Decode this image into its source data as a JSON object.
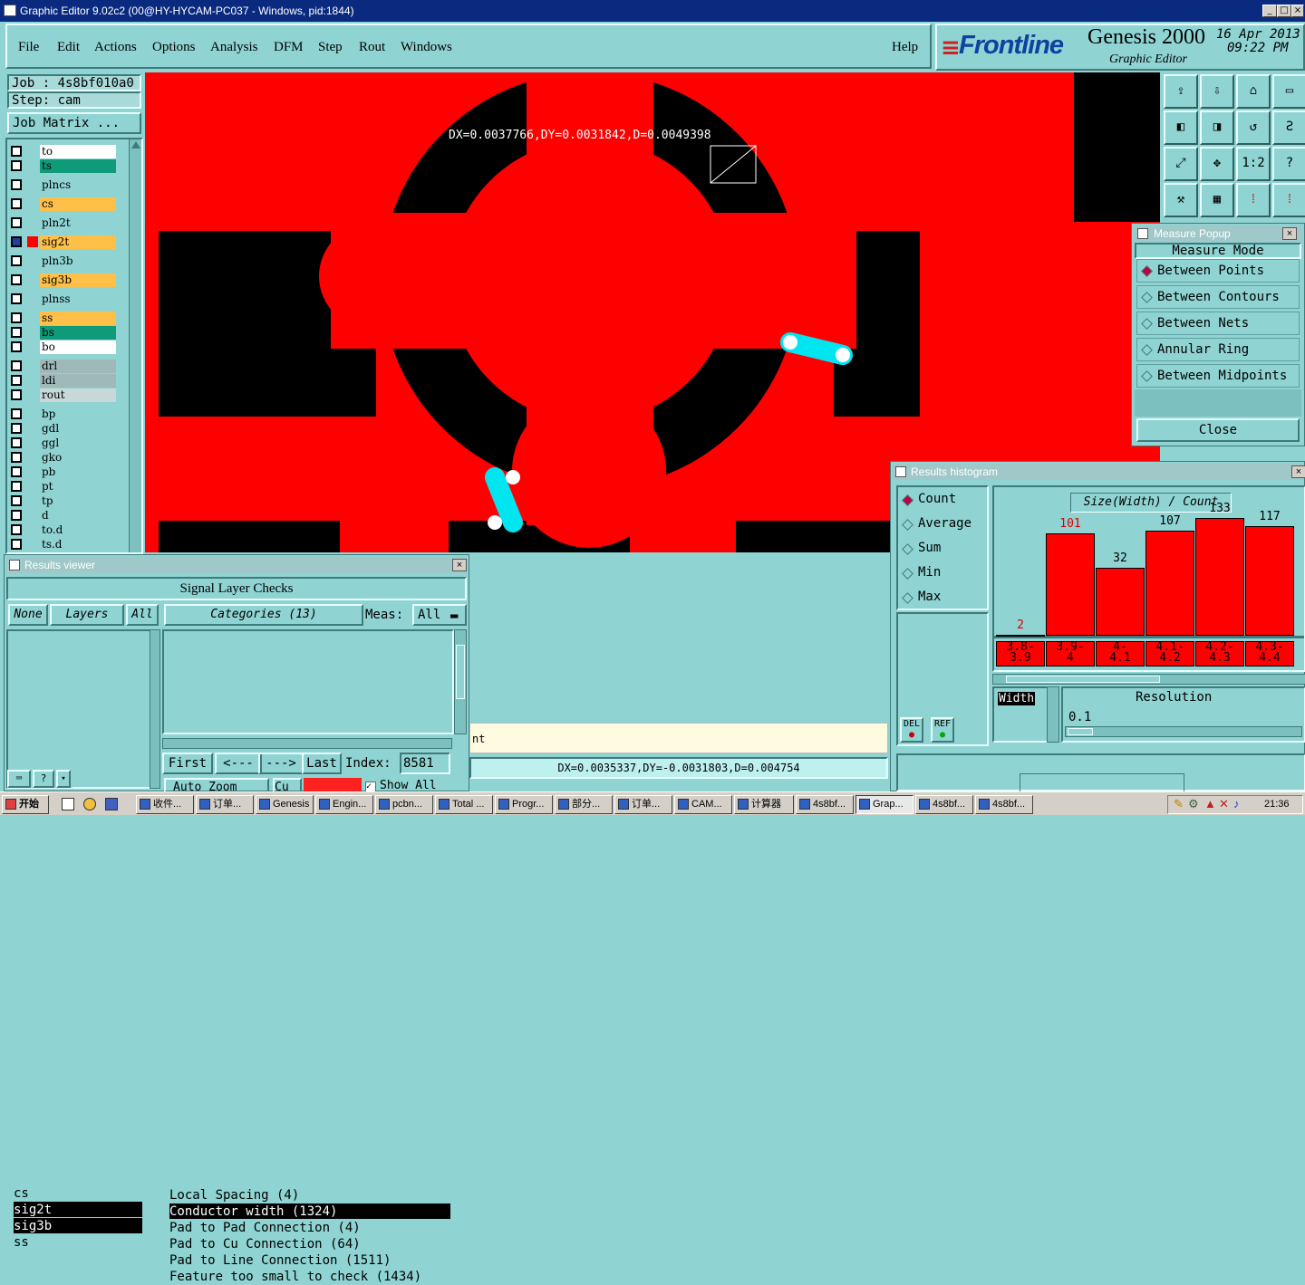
{
  "window": {
    "title": "Graphic Editor 9.02c2 (00@HY-HYCAM-PC037 - Windows, pid:1844)"
  },
  "menu": [
    "File",
    "Edit",
    "Actions",
    "Options",
    "Analysis",
    "DFM",
    "Step",
    "Rout",
    "Windows"
  ],
  "help": "Help",
  "brand": {
    "logo": "Frontline",
    "product": "Genesis 2000",
    "subtitle": "Graphic Editor",
    "date": "16 Apr 2013",
    "time": "09:22 PM"
  },
  "job": {
    "job": "Job : 4s8bf010a0",
    "step": "Step: cam",
    "matrix": "Job Matrix ..."
  },
  "layers": [
    {
      "name": "to",
      "color": "#ffffff"
    },
    {
      "name": "ts",
      "color": "#0f9a7a"
    },
    {
      "name": "plncs",
      "color": "#8fd3d3"
    },
    {
      "name": "cs",
      "color": "#ffc04a"
    },
    {
      "name": "pln2t",
      "color": "#8fd3d3"
    },
    {
      "name": "sig2t",
      "color": "#ffc04a"
    },
    {
      "name": "pln3b",
      "color": "#8fd3d3"
    },
    {
      "name": "sig3b",
      "color": "#ffc04a"
    },
    {
      "name": "plnss",
      "color": "#8fd3d3"
    },
    {
      "name": "ss",
      "color": "#ffc04a"
    },
    {
      "name": "bs",
      "color": "#0f9a7a"
    },
    {
      "name": "bo",
      "color": "#ffffff"
    },
    {
      "name": "drl",
      "color": "#9fb8b8"
    },
    {
      "name": "ldi",
      "color": "#9fb8b8"
    },
    {
      "name": "rout",
      "color": "#c8d8d8"
    },
    {
      "name": "bp",
      "color": "#8fd3d3"
    },
    {
      "name": "gdl",
      "color": "#8fd3d3"
    },
    {
      "name": "ggl",
      "color": "#8fd3d3"
    },
    {
      "name": "gko",
      "color": "#8fd3d3"
    },
    {
      "name": "pb",
      "color": "#8fd3d3"
    },
    {
      "name": "pt",
      "color": "#8fd3d3"
    },
    {
      "name": "tp",
      "color": "#8fd3d3"
    },
    {
      "name": "d",
      "color": "#8fd3d3"
    },
    {
      "name": "to.d",
      "color": "#8fd3d3"
    },
    {
      "name": "ts.d",
      "color": "#8fd3d3"
    }
  ],
  "canvas": {
    "measure_text": "DX=0.0037766,DY=0.0031842,D=0.0049398"
  },
  "toolbar_icons": [
    "step-up-icon",
    "step-down-icon",
    "home-icon",
    "panel-icon",
    "pan-left-icon",
    "pan-right-icon",
    "undo-zoom-icon",
    "route-icon",
    "zoom-fit-icon",
    "zoom-center-icon",
    "one-to-one-icon",
    "help-icon",
    "tool-icon",
    "grid-icon",
    "layer-sig-icon",
    "layer-pad-icon"
  ],
  "one_to_one": "1:2",
  "question": "?",
  "measure": {
    "title": "Measure Popup",
    "mode": "Measure Mode",
    "options": [
      "Between Points",
      "Between Contours",
      "Between Nets",
      "Annular Ring",
      "Between Midpoints"
    ],
    "selected": 0,
    "close": "Close"
  },
  "histogram": {
    "title": "Results histogram",
    "modes": [
      "Count",
      "Average",
      "Sum",
      "Min",
      "Max"
    ],
    "selected": 0,
    "chart_title": "Size(Width) / Count",
    "del": "DEL",
    "ref": "REF",
    "field": "Width",
    "resolution_label": "Resolution",
    "resolution": "0.1"
  },
  "chart_data": {
    "type": "bar",
    "title": "Size(Width) / Count",
    "categories": [
      "3.8-3.9",
      "3.9-4",
      "4-4.1",
      "4.1-4.2",
      "4.2-4.3",
      "4.3-4.4"
    ],
    "cat_top": [
      "3.8-",
      "3.9-",
      "4-",
      "4.1-",
      "4.2-",
      "4.3-"
    ],
    "cat_bottom": [
      "3.9",
      "4",
      "4.1",
      "4.2",
      "4.3",
      "4.4"
    ],
    "values": [
      2,
      101,
      32,
      107,
      133,
      117
    ],
    "ylim": [
      0,
      133
    ]
  },
  "results": {
    "title": "Results viewer",
    "header": "Signal Layer Checks",
    "none": "None",
    "layers_btn": "Layers",
    "all": "All",
    "categories": "Categories (13)",
    "meas_label": "Meas:",
    "meas_val": "All",
    "layer_list": [
      "cs",
      "sig2t",
      "sig3b",
      "ss"
    ],
    "cat_list": [
      "Local Spacing (4)",
      "Conductor width (1324)",
      "Pad to Pad Connection (4)",
      "Pad to Cu Connection (64)",
      "Pad to Line Connection (1511)",
      "Feature too small to check (1434)"
    ],
    "first": "First",
    "prev": "<---",
    "next": "--->",
    "last": "Last",
    "index_label": "Index:",
    "index": "8581",
    "auto_zoom": "Auto Zoom",
    "show_all": "Show All",
    "cu": "Cu"
  },
  "status": {
    "partial": "nt",
    "measure": "DX=0.0035337,DY=-0.0031803,D=0.004754"
  },
  "taskbar": {
    "start": "开始",
    "tasks": [
      "收件...",
      "订单...",
      "Genesis",
      "Engin...",
      "pcbn...",
      "Total ...",
      "Progr...",
      "部分...",
      "订单...",
      "CAM...",
      "计算器",
      "4s8bf...",
      "Grap...",
      "4s8bf...",
      "4s8bf..."
    ],
    "clock": "21:36"
  }
}
